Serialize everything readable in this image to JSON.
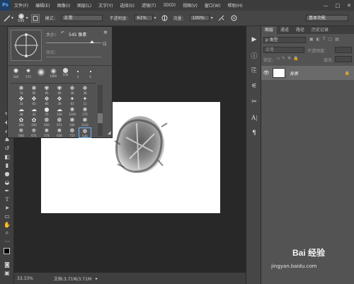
{
  "app": {
    "logo": "Ps",
    "workspace": "基本功能"
  },
  "menu": [
    "文件(F)",
    "编辑(E)",
    "图像(I)",
    "图层(L)",
    "文字(Y)",
    "选择(S)",
    "滤镜(T)",
    "3D(D)",
    "视图(V)",
    "窗口(W)",
    "帮助(H)"
  ],
  "window_controls": [
    "—",
    "□",
    "✕"
  ],
  "options": {
    "brush_size": "545",
    "mode_label": "模式：",
    "mode_value": "正常",
    "opacity_label": "不透明度：",
    "opacity_value": "61%",
    "flow_label": "流量：",
    "flow_value": "100%"
  },
  "brush_panel": {
    "size_label": "大小：",
    "size_value": "545 像素",
    "hardness_label": "硬度：",
    "presets_row1": [
      "545",
      "575",
      "",
      "1400",
      "100",
      "1",
      "2"
    ],
    "presets": [
      [
        "74",
        "95",
        "95",
        "90",
        "36",
        "36"
      ],
      [
        "33",
        "63",
        "66",
        "39",
        "63",
        "11"
      ],
      [
        "48",
        "32",
        "55",
        "100",
        "1194",
        "175"
      ],
      [
        "306",
        "350",
        "650",
        "971",
        "500",
        "1122"
      ],
      [
        "640",
        "671",
        "574",
        "636",
        "757",
        "545"
      ]
    ]
  },
  "status": {
    "zoom": "33.33%",
    "doc": "文档:3.71M/3.71M"
  },
  "layers_panel": {
    "tabs": [
      "图层",
      "通道",
      "路径",
      "历史记录"
    ],
    "kind_placeholder": "p 类型",
    "blend_mode": "正常",
    "opacity_label": "不透明度:",
    "lock_label": "锁定:",
    "fill_label": "填充:",
    "layer_name": "背景"
  },
  "watermark": {
    "brand": "Bai 经验",
    "url": "jingyan.baidu.com"
  },
  "colors": {
    "menubar": "#3c3c3c",
    "options": "#464646",
    "canvas_bg": "#282828",
    "panel": "#535353",
    "accent_blue": "#1f3f66"
  }
}
